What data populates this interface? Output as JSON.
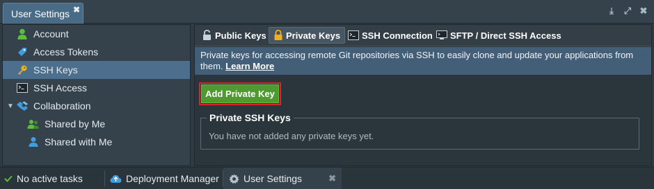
{
  "window": {
    "tab_title": "User Settings",
    "close_glyph": "✖"
  },
  "window_controls": [
    {
      "icon": "download-icon",
      "glyph": "⤓"
    },
    {
      "icon": "expand-icon",
      "glyph": "⤢"
    },
    {
      "icon": "close-icon",
      "glyph": "✖"
    }
  ],
  "sidebar": {
    "items": [
      {
        "label": "Account",
        "icon": "account-icon"
      },
      {
        "label": "Access Tokens",
        "icon": "tag-icon"
      },
      {
        "label": "SSH Keys",
        "icon": "key-icon",
        "active": true
      },
      {
        "label": "SSH Access",
        "icon": "terminal-icon"
      },
      {
        "label": "Collaboration",
        "icon": "handshake-icon"
      },
      {
        "label": "Shared by Me",
        "icon": "users-icon"
      },
      {
        "label": "Shared with Me",
        "icon": "user-share-icon"
      }
    ]
  },
  "tabs": [
    {
      "label": "Public Keys",
      "icon": "lock-open-icon"
    },
    {
      "label": "Private Keys",
      "icon": "lock-icon",
      "active": true
    },
    {
      "label": "SSH Connection",
      "icon": "terminal-icon"
    },
    {
      "label": "SFTP / Direct SSH Access",
      "icon": "monitor-icon"
    }
  ],
  "info": {
    "text": "Private keys for accessing remote Git repositories via SSH to easily clone and update your applications from them.",
    "link": "Learn More"
  },
  "main": {
    "add_button": "Add Private Key",
    "section_title": "Private SSH Keys",
    "empty_text": "You have not added any private keys yet."
  },
  "taskbar": {
    "status": "No active tasks",
    "items": [
      {
        "label": "Deployment Manager",
        "icon": "cloud-icon"
      },
      {
        "label": "User Settings",
        "icon": "gear-icon",
        "active": true
      }
    ],
    "close_glyph": "✖"
  },
  "colors": {
    "accent": "#4b6f8d",
    "button_green": "#4f9a2f",
    "highlight_red": "#d9262c",
    "info_bg": "#435f78"
  }
}
